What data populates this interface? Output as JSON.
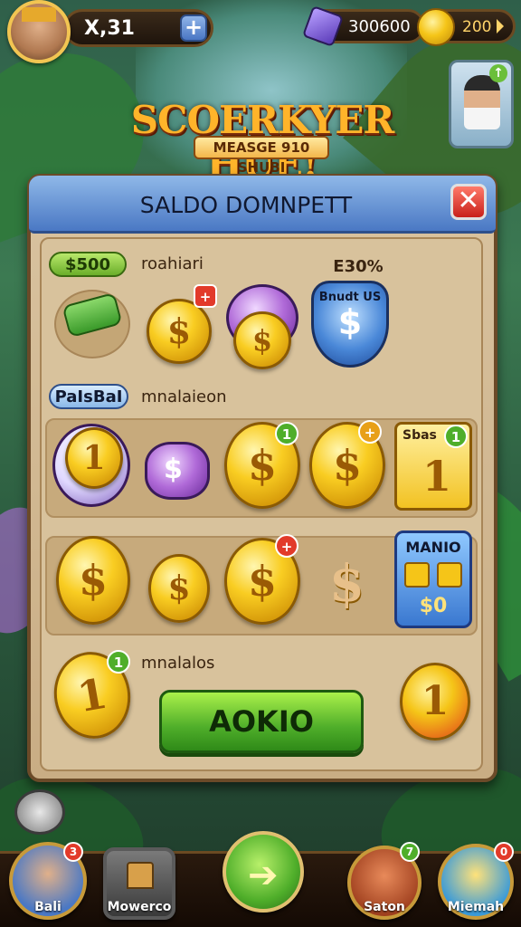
{
  "top_bar": {
    "coins_value": "X,31",
    "plus_label": "+",
    "gems_value": "300600",
    "gold_value": "200"
  },
  "logo": {
    "title": "SCOERKYER HUE!",
    "subtitle": "MEASGE 910 SHUBI"
  },
  "panel": {
    "title": "SALDO DOMNPETT",
    "close_label": "✕",
    "row1": {
      "price_tag": "$500",
      "label": "roahiari",
      "bonus_tag": "E30%",
      "shield_text": "Bnudt US",
      "shield_symbol": "$",
      "badge_a": "+",
      "coin_symbol": "$"
    },
    "section2": {
      "tag": "PaIsBaI",
      "label": "mnalaieon"
    },
    "row2": {
      "badge_1": "1",
      "badge_2": "+",
      "card_label": "Sbas",
      "card_badge": "1",
      "card_value": "1"
    },
    "row3": {
      "badge_1": "+",
      "card_title": "MANIO",
      "card_value": "$0"
    },
    "row4": {
      "label": "mnalalos",
      "badge": "1",
      "okay_label": "AOKIO"
    }
  },
  "bottom_nav": {
    "items": [
      {
        "label": "Bali",
        "badge": "3"
      },
      {
        "label": "Mowerco",
        "badge": ""
      },
      {
        "label": "",
        "badge": ""
      },
      {
        "label": "Saton",
        "badge": "7"
      },
      {
        "label": "Miemah",
        "badge": "0"
      }
    ]
  }
}
